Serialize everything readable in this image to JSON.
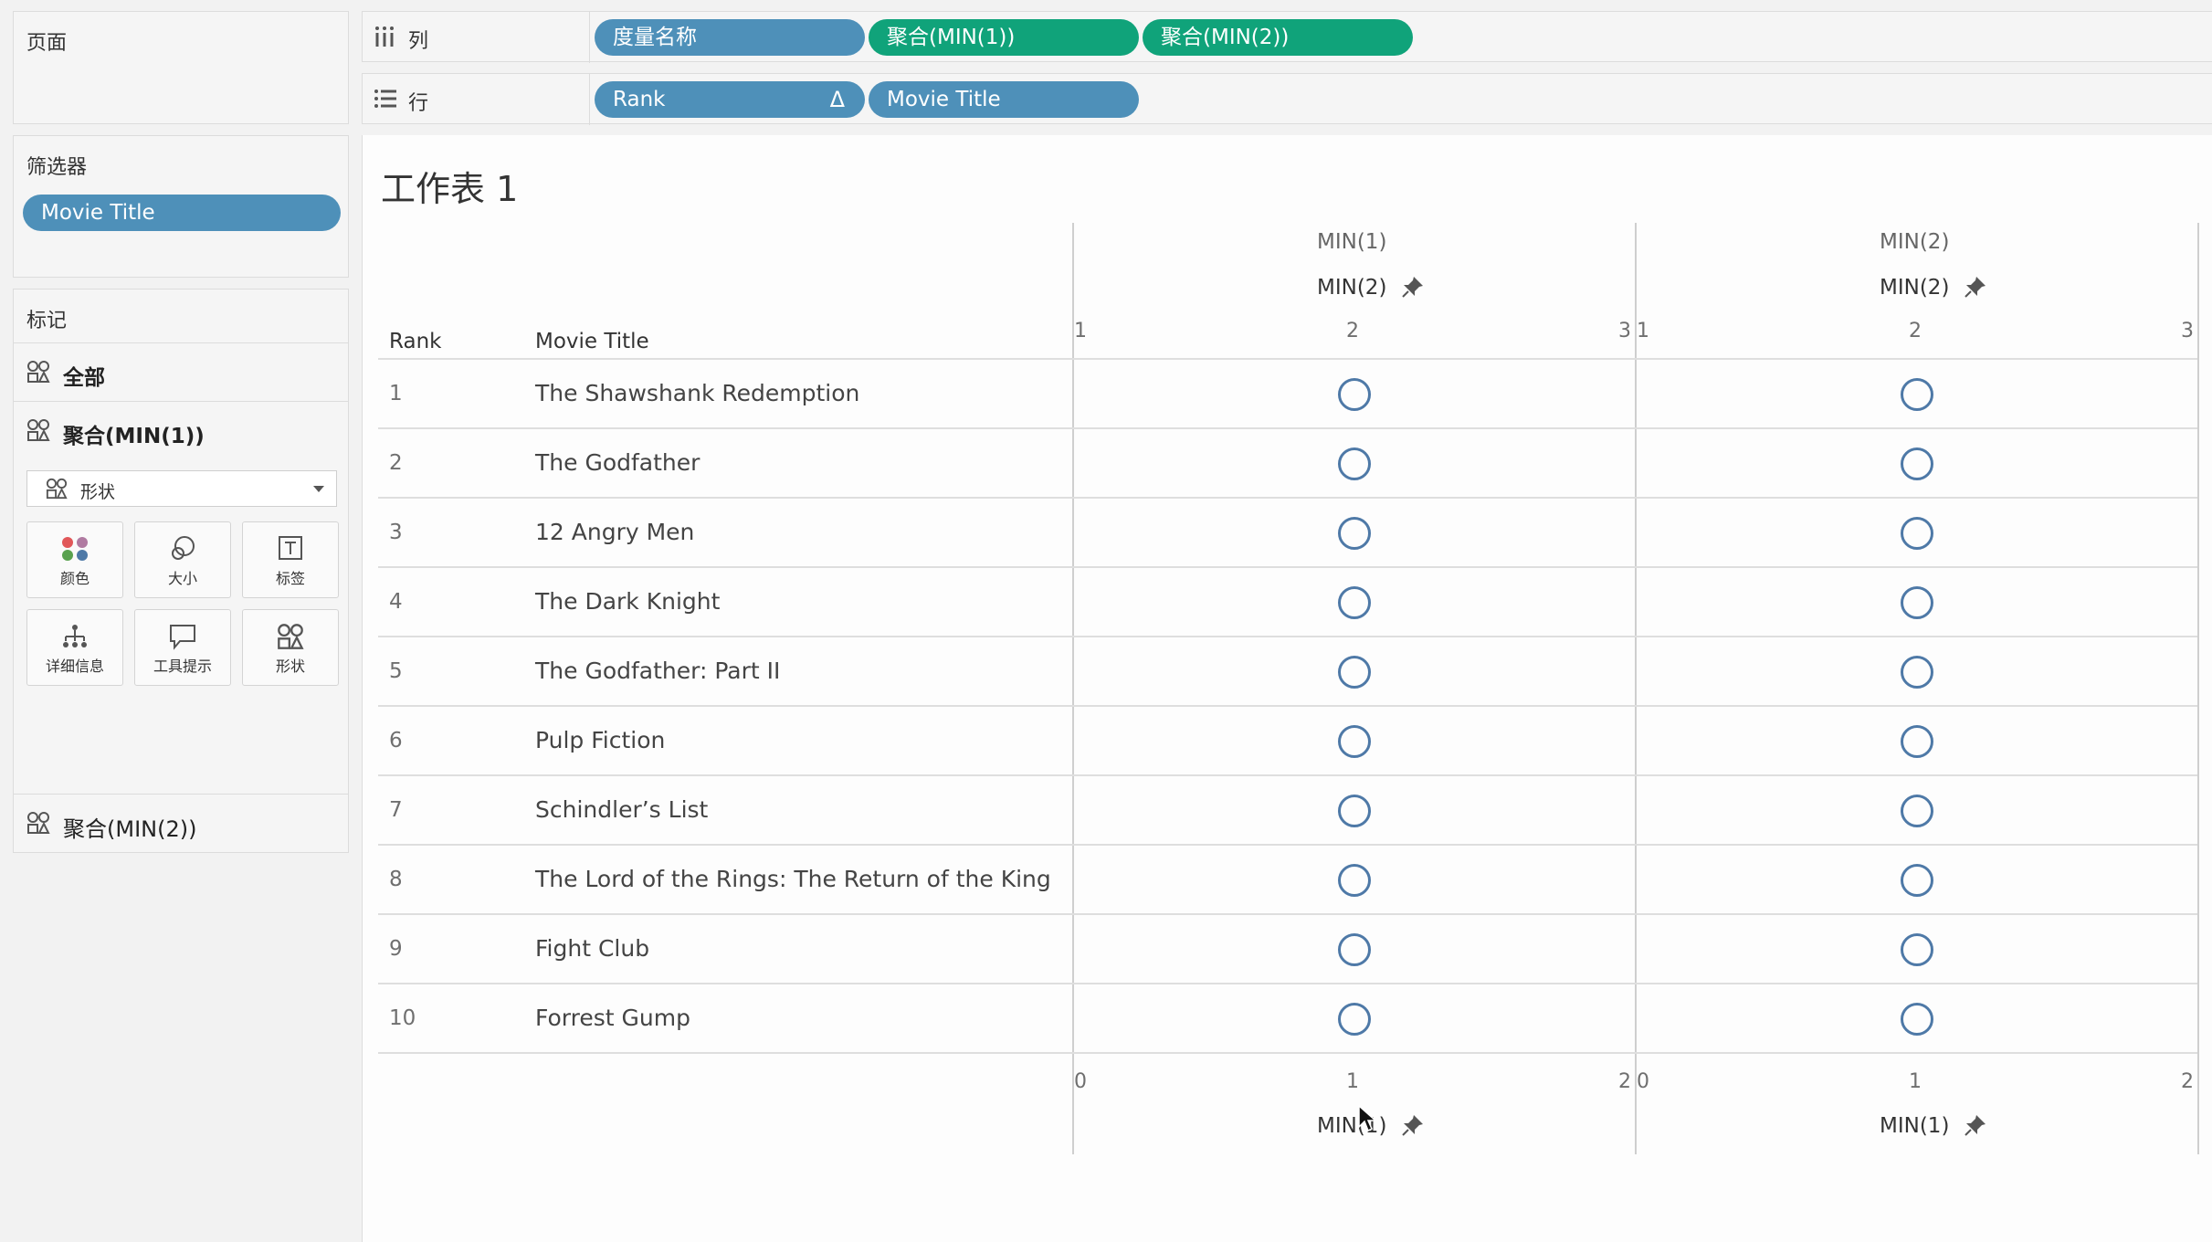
{
  "pages_panel": {
    "title": "页面"
  },
  "filters_panel": {
    "title": "筛选器",
    "pill": "Movie Title"
  },
  "marks_panel": {
    "title": "标记",
    "all": "全部",
    "agg1": "聚合(MIN(1))",
    "mark_type": "形状",
    "buttons": [
      "颜色",
      "大小",
      "标签",
      "详细信息",
      "工具提示",
      "形状"
    ],
    "agg2": "聚合(MIN(2))"
  },
  "shelves": {
    "columns_label": "列",
    "columns_pills": [
      "度量名称",
      "聚合(MIN(1))",
      "聚合(MIN(2))"
    ],
    "rows_label": "行",
    "rows_pills": [
      "Rank",
      "Movie Title"
    ],
    "sort_glyph": "Δ"
  },
  "sheet": {
    "title": "工作表 1",
    "headers": {
      "rank": "Rank",
      "movie": "Movie Title",
      "col1": "MIN(1)",
      "col2": "MIN(2)"
    },
    "top_axis_title": "MIN(2)",
    "bottom_axis_title": "MIN(1)",
    "top_ticks": [
      "1",
      "2",
      "3"
    ],
    "bottom_ticks": [
      "0",
      "1",
      "2"
    ]
  },
  "chart_data": {
    "type": "scatter",
    "panes": [
      "MIN(1)",
      "MIN(2)"
    ],
    "rows": [
      {
        "rank": "1",
        "title": "The Shawshank Redemption",
        "min1": 1,
        "min2": 2
      },
      {
        "rank": "2",
        "title": "The Godfather",
        "min1": 1,
        "min2": 2
      },
      {
        "rank": "3",
        "title": "12 Angry Men",
        "min1": 1,
        "min2": 2
      },
      {
        "rank": "4",
        "title": "The Dark Knight",
        "min1": 1,
        "min2": 2
      },
      {
        "rank": "5",
        "title": "The Godfather: Part II",
        "min1": 1,
        "min2": 2
      },
      {
        "rank": "6",
        "title": "Pulp Fiction",
        "min1": 1,
        "min2": 2
      },
      {
        "rank": "7",
        "title": "Schindler’s List",
        "min1": 1,
        "min2": 2
      },
      {
        "rank": "8",
        "title": "The Lord of the Rings: The Return of the King",
        "min1": 1,
        "min2": 2
      },
      {
        "rank": "9",
        "title": "Fight Club",
        "min1": 1,
        "min2": 2
      },
      {
        "rank": "10",
        "title": "Forrest Gump",
        "min1": 1,
        "min2": 2
      }
    ],
    "top_axis": {
      "title": "MIN(2)",
      "range": [
        1,
        3
      ]
    },
    "bottom_axis": {
      "title": "MIN(1)",
      "range": [
        0,
        2
      ]
    },
    "mark_color": "#4e79a7",
    "mark_shape": "open-circle"
  },
  "colors": {
    "blue_pill": "#4e90b9",
    "green_pill": "#10a37a",
    "mark": "#4e79a7"
  }
}
